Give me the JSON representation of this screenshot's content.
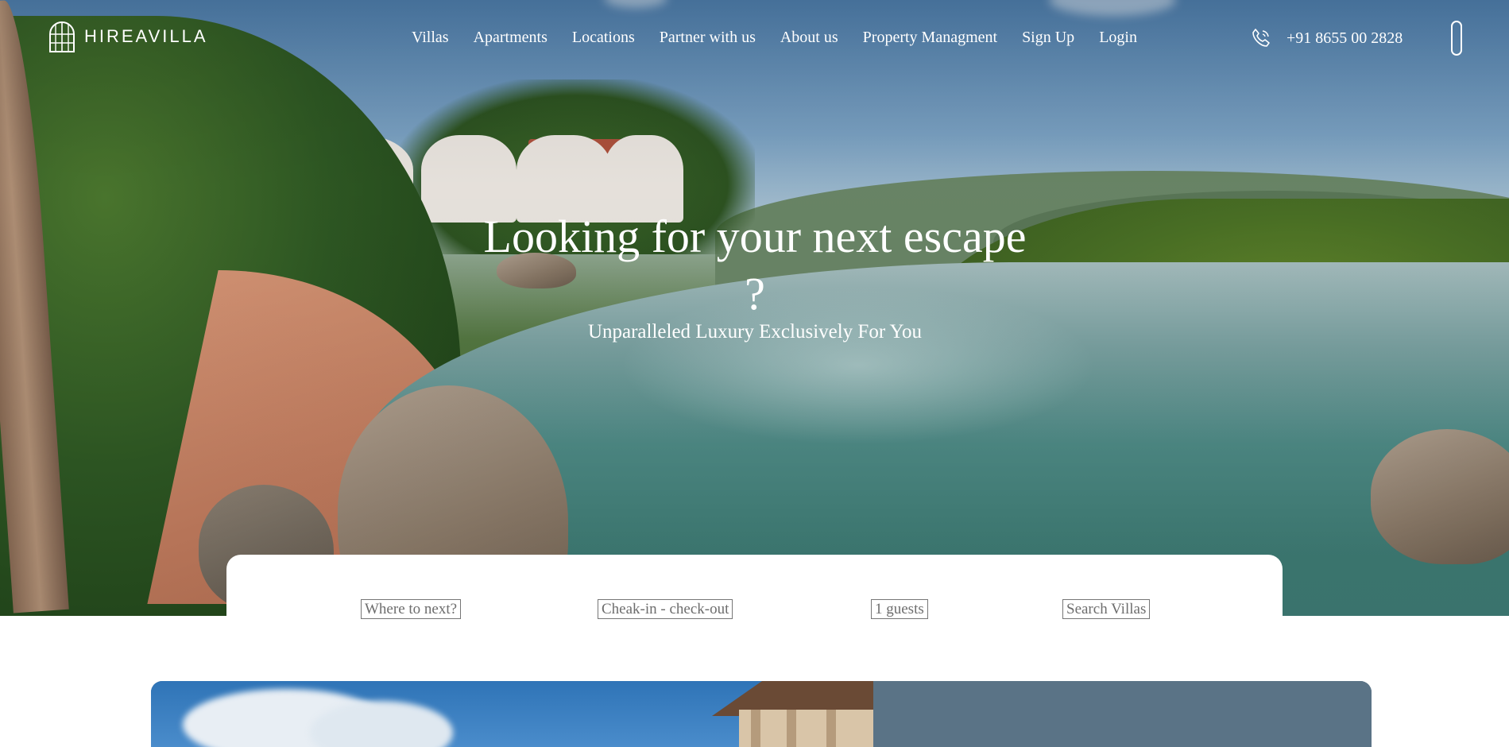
{
  "brand": {
    "name": "HIREAVILLA",
    "logo_icon": "arched-window-icon"
  },
  "nav": {
    "items": [
      {
        "label": "Villas"
      },
      {
        "label": "Apartments"
      },
      {
        "label": "Locations"
      },
      {
        "label": "Partner with us"
      },
      {
        "label": "About us"
      },
      {
        "label": "Property Managment"
      },
      {
        "label": "Sign Up"
      },
      {
        "label": "Login"
      }
    ],
    "phone": {
      "icon": "phone-icon",
      "number": "+91 8655 00 2828"
    },
    "menu_toggle_icon": "menu-toggle-icon"
  },
  "hero": {
    "title": "Looking for your next escape ?",
    "subtitle": "Unparalleled Luxury Exclusively For You"
  },
  "search": {
    "destination_placeholder": "Where to next?",
    "dates_placeholder": "Cheak-in - check-out",
    "guests_value": "1 guests",
    "submit_label": "Search Villas"
  },
  "colors": {
    "nav_text": "#ffffff",
    "search_card_bg": "#ffffff",
    "feature_panel_bg": "#5a7386"
  }
}
